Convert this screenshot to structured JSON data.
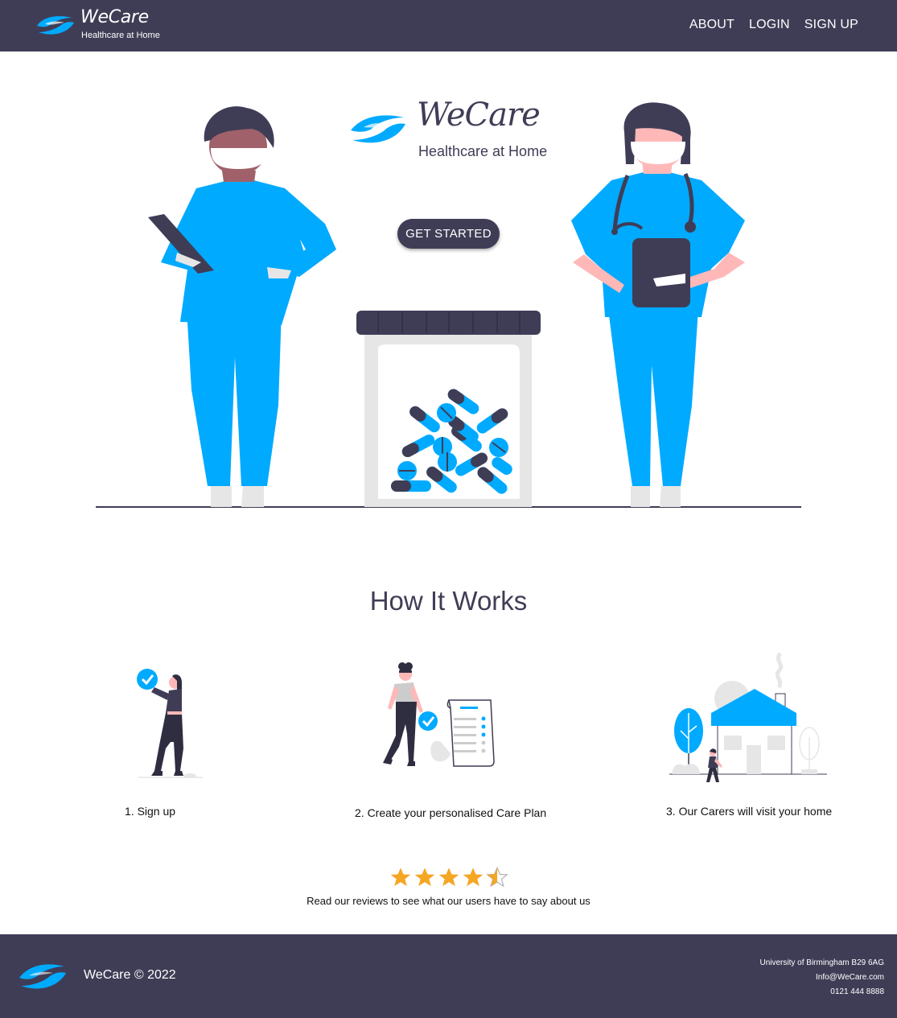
{
  "nav": {
    "brand_title": "WeCare",
    "brand_subtitle": "Healthcare at Home",
    "links": [
      "ABOUT",
      "LOGIN",
      "SIGN UP"
    ]
  },
  "hero": {
    "brand_title": "WeCare",
    "brand_subtitle": "Healthcare at Home",
    "cta_label": "GET STARTED"
  },
  "how_it_works": {
    "title": "How It Works",
    "steps": [
      {
        "label": "1. Sign up",
        "icon": "sign-up-illustration"
      },
      {
        "label": "2. Create your personalised Care Plan",
        "icon": "care-plan-illustration"
      },
      {
        "label": "3. Our Carers will visit your home",
        "icon": "home-visit-illustration"
      }
    ]
  },
  "reviews": {
    "rating": 4.5,
    "max_rating": 5,
    "text": "Read our reviews to see what our users have to say about us"
  },
  "footer": {
    "copyright": "WeCare © 2022",
    "address": "University of Birmingham B29 6AG",
    "email": "Info@WeCare.com",
    "phone": "0121 444 8888"
  },
  "colors": {
    "primary_dark": "#3f3d56",
    "accent_blue": "#00aaff",
    "star": "#f5a623",
    "skin_light": "#ffb8b8",
    "skin_dark": "#a0616a"
  }
}
